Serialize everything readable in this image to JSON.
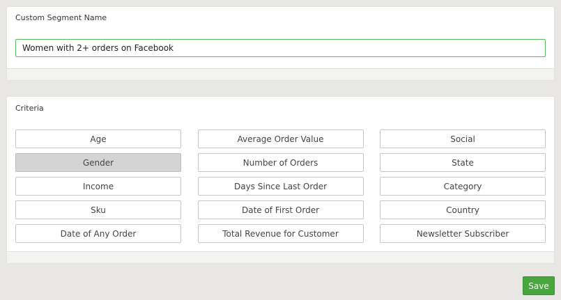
{
  "segment_name": {
    "label": "Custom Segment Name",
    "value": "Women with 2+ orders on Facebook"
  },
  "criteria": {
    "label": "Criteria",
    "buttons": [
      {
        "label": "Age",
        "selected": false
      },
      {
        "label": "Average Order Value",
        "selected": false
      },
      {
        "label": "Social",
        "selected": false
      },
      {
        "label": "Gender",
        "selected": true
      },
      {
        "label": "Number of Orders",
        "selected": false
      },
      {
        "label": "State",
        "selected": false
      },
      {
        "label": "Income",
        "selected": false
      },
      {
        "label": "Days Since Last Order",
        "selected": false
      },
      {
        "label": "Category",
        "selected": false
      },
      {
        "label": "Sku",
        "selected": false
      },
      {
        "label": "Date of First Order",
        "selected": false
      },
      {
        "label": "Country",
        "selected": false
      },
      {
        "label": "Date of Any Order",
        "selected": false
      },
      {
        "label": "Total Revenue for Customer",
        "selected": false
      },
      {
        "label": "Newsletter Subscriber",
        "selected": false
      }
    ]
  },
  "actions": {
    "save_label": "Save"
  },
  "colors": {
    "save_button": "#47a63c",
    "input_focus_border": "#5cb85c",
    "selected_button": "#d4d4d4"
  }
}
